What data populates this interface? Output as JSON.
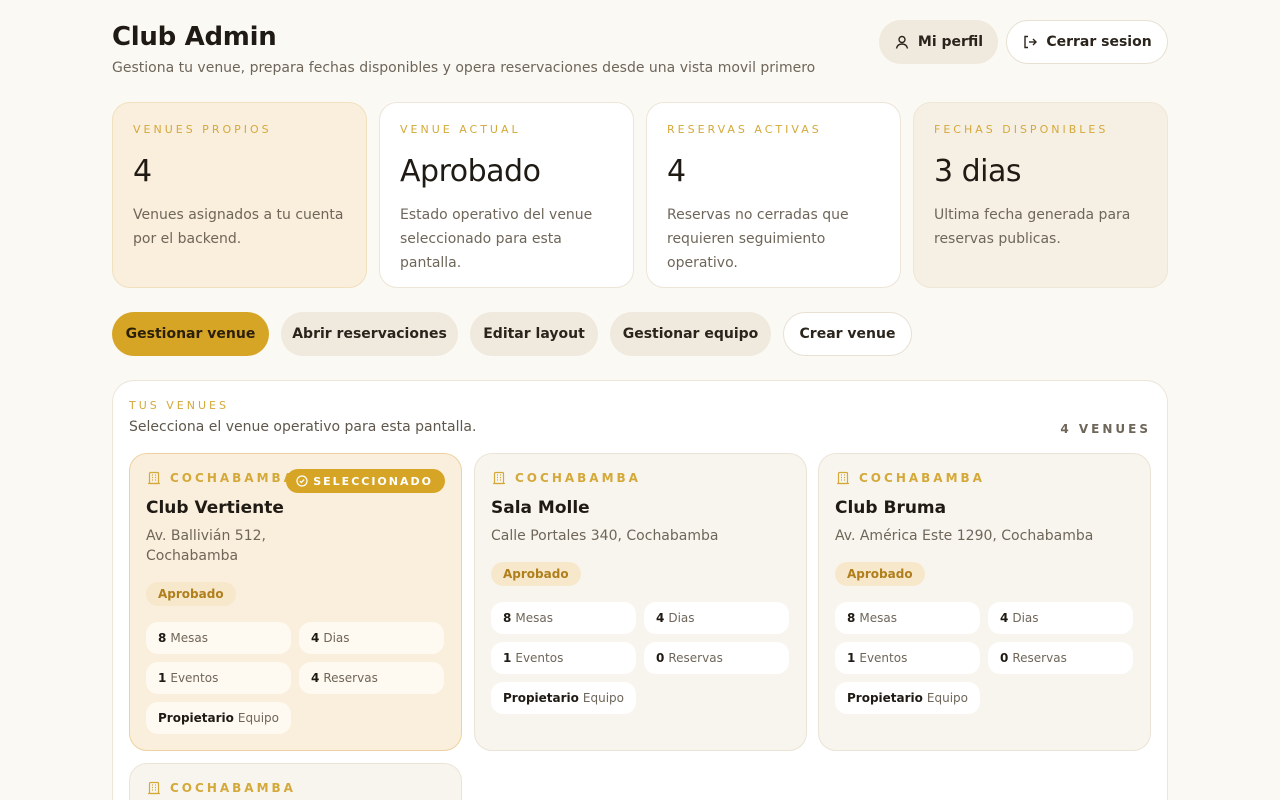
{
  "header": {
    "title": "Club Admin",
    "subtitle": "Gestiona tu venue, prepara fechas disponibles y opera reservaciones desde una vista movil primero",
    "profile_label": "Mi perfil",
    "logout_label": "Cerrar sesion"
  },
  "stats": [
    {
      "label": "VENUES PROPIOS",
      "value": "4",
      "desc": "Venues asignados a tu cuenta por el backend."
    },
    {
      "label": "VENUE ACTUAL",
      "value": "Aprobado",
      "desc": "Estado operativo del venue seleccionado para esta pantalla."
    },
    {
      "label": "RESERVAS ACTIVAS",
      "value": "4",
      "desc": "Reservas no cerradas que requieren seguimiento operativo."
    },
    {
      "label": "FECHAS DISPONIBLES",
      "value": "3 dias",
      "desc": "Ultima fecha generada para reservas publicas."
    }
  ],
  "actions": {
    "manage_venue": "Gestionar venue",
    "open_reservations": "Abrir reservaciones",
    "edit_layout": "Editar layout",
    "manage_team": "Gestionar equipo",
    "create_venue": "Crear venue"
  },
  "venues_panel": {
    "kicker": "TUS VENUES",
    "subtitle": "Selecciona el venue operativo para esta pantalla.",
    "count": "4 VENUES",
    "venues": [
      {
        "city": "COCHABAMBA",
        "badge": "SELECCIONADO",
        "name": "Club Vertiente",
        "address": "Av. Ballivián 512, Cochabamba",
        "status": "Aprobado",
        "chips": {
          "tables_n": "8",
          "tables_l": "Mesas",
          "days_n": "4",
          "days_l": "Dias",
          "events_n": "1",
          "events_l": "Eventos",
          "res_n": "4",
          "res_l": "Reservas",
          "owner_b": "Propietario",
          "owner_l": "Equipo"
        }
      },
      {
        "city": "COCHABAMBA",
        "name": "Sala Molle",
        "address": "Calle Portales 340, Cochabamba",
        "status": "Aprobado",
        "chips": {
          "tables_n": "8",
          "tables_l": "Mesas",
          "days_n": "4",
          "days_l": "Dias",
          "events_n": "1",
          "events_l": "Eventos",
          "res_n": "0",
          "res_l": "Reservas",
          "owner_b": "Propietario",
          "owner_l": "Equipo"
        }
      },
      {
        "city": "COCHABAMBA",
        "name": "Club Bruma",
        "address": "Av. América Este 1290, Cochabamba",
        "status": "Aprobado",
        "chips": {
          "tables_n": "8",
          "tables_l": "Mesas",
          "days_n": "4",
          "days_l": "Dias",
          "events_n": "1",
          "events_l": "Eventos",
          "res_n": "0",
          "res_l": "Reservas",
          "owner_b": "Propietario",
          "owner_l": "Equipo"
        }
      },
      {
        "city": "COCHABAMBA"
      }
    ]
  },
  "icons": {
    "profile": "user-icon",
    "logout": "logout-icon",
    "city": "building-icon",
    "selected": "check-circle-icon"
  },
  "colors": {
    "accent": "#d6a525",
    "accent_text": "#d4a93a",
    "background": "#fbf9f4",
    "highlight_card": "#faefdc"
  }
}
